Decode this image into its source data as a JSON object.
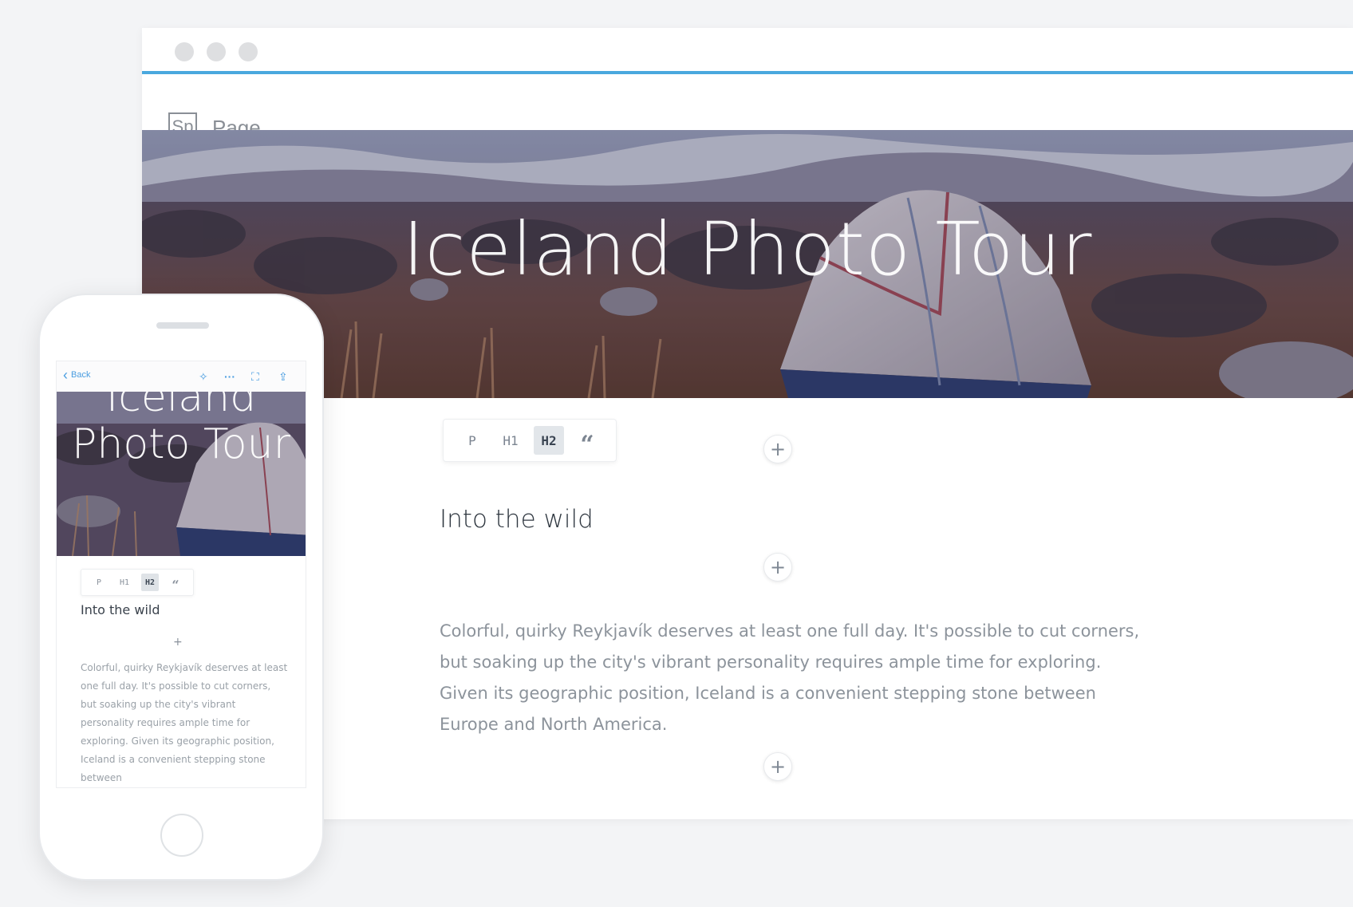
{
  "window": {
    "app_logo": "Sp",
    "page_label": "Page",
    "traffic_lights": [
      "close",
      "minimize",
      "zoom"
    ]
  },
  "hero": {
    "title": "Iceland Photo Tour"
  },
  "format_toolbar": {
    "options": [
      "P",
      "H1",
      "H2",
      "“"
    ],
    "active": "H2"
  },
  "content": {
    "heading": "Into the wild",
    "paragraph": "Colorful, quirky Reykjavík deserves at least one full day. It's possible to cut corners, but soaking up the city's vibrant personality requires ample time for exploring. Given its geographic position, Iceland is a convenient stepping stone between Europe and North America."
  },
  "add_block": {
    "glyph": "+"
  },
  "phone": {
    "nav_back_label": "Back",
    "hero_title": "Iceland Photo Tour",
    "toolbar_options": [
      "P",
      "H1",
      "H2",
      "“"
    ],
    "heading": "Into the wild",
    "add_glyph": "+",
    "paragraph": "Colorful, quirky Reykjavík deserves at least one full day. It's possible to cut corners, but soaking up the city's vibrant personality requires ample time for exploring. Given its geographic position, Iceland is a convenient stepping stone between"
  },
  "colors": {
    "accent": "#4aa8de",
    "background": "#f3f4f6",
    "text_dark": "#2f3740",
    "text_muted": "#8c939b"
  },
  "icons": {
    "nav_back": "chevron-left-icon",
    "nav_actions": [
      "magic-wand-icon",
      "more-icon",
      "preview-icon",
      "share-icon"
    ],
    "add": "plus-icon"
  }
}
